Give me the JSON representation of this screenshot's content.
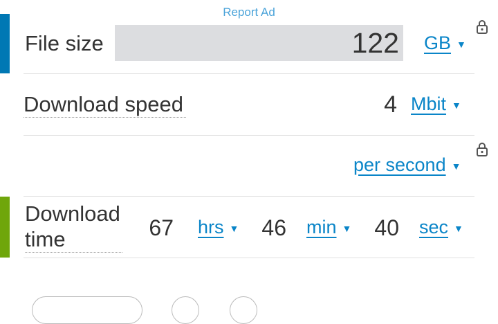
{
  "report_ad": "Report Ad",
  "file_size": {
    "label": "File size",
    "value": "122",
    "unit": "GB"
  },
  "download_speed": {
    "label": "Download speed",
    "value": "4",
    "unit": "Mbit",
    "per_unit": "per second"
  },
  "download_time": {
    "label_line1": "Download",
    "label_line2": "time",
    "hours_value": "67",
    "hours_unit": "hrs",
    "minutes_value": "46",
    "minutes_unit": "min",
    "seconds_value": "40",
    "seconds_unit": "sec"
  },
  "icons": {
    "dropdown": "chevron-down-icon",
    "lock": "lock-icon"
  },
  "colors": {
    "accent_blue": "#0078b4",
    "accent_green": "#6fa60b",
    "link": "#0a85c8",
    "input_bg": "#dcdde0"
  }
}
